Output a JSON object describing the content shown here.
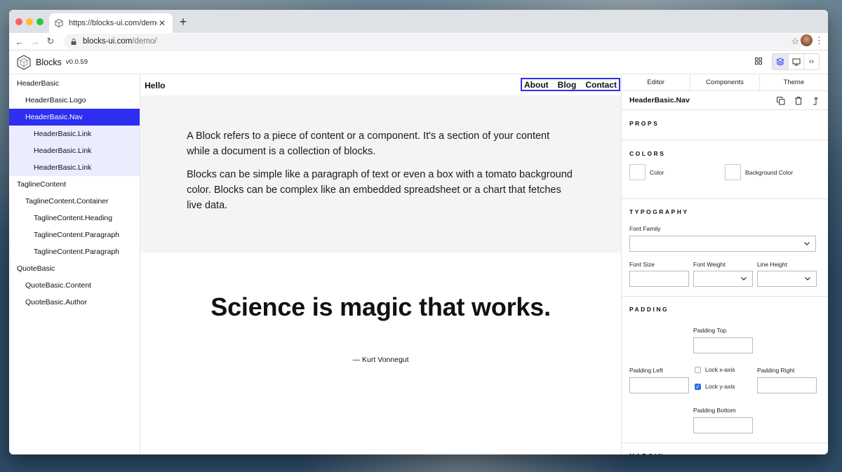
{
  "browser": {
    "tab_title": "https://blocks-ui.com/demo/",
    "url_host": "blocks-ui.com",
    "url_path": "/demo/"
  },
  "app": {
    "brand": "Blocks",
    "version": "v0.0.59",
    "accent_color": "#2d2ef0"
  },
  "tree": [
    {
      "label": "HeaderBasic",
      "level": 0,
      "state": ""
    },
    {
      "label": "HeaderBasic.Logo",
      "level": 1,
      "state": ""
    },
    {
      "label": "HeaderBasic.Nav",
      "level": 1,
      "state": "selected"
    },
    {
      "label": "HeaderBasic.Link",
      "level": 2,
      "state": "child-sel"
    },
    {
      "label": "HeaderBasic.Link",
      "level": 2,
      "state": "child-sel"
    },
    {
      "label": "HeaderBasic.Link",
      "level": 2,
      "state": "child-sel"
    },
    {
      "label": "TaglineContent",
      "level": 0,
      "state": ""
    },
    {
      "label": "TaglineContent.Container",
      "level": 1,
      "state": ""
    },
    {
      "label": "TaglineContent.Heading",
      "level": 2,
      "state": ""
    },
    {
      "label": "TaglineContent.Paragraph",
      "level": 2,
      "state": ""
    },
    {
      "label": "TaglineContent.Paragraph",
      "level": 2,
      "state": ""
    },
    {
      "label": "QuoteBasic",
      "level": 0,
      "state": ""
    },
    {
      "label": "QuoteBasic.Content",
      "level": 1,
      "state": ""
    },
    {
      "label": "QuoteBasic.Author",
      "level": 1,
      "state": ""
    }
  ],
  "canvas": {
    "logo": "Hello",
    "nav": [
      "About",
      "Blog",
      "Contact"
    ],
    "paragraph1": "A Block refers to a piece of content or a component. It's a section of your content while a document is a collection of blocks.",
    "paragraph2": "Blocks can be simple like a paragraph of text or even a box with a tomato background color. Blocks can be complex like an embedded spreadsheet or a chart that fetches live data.",
    "quote": "Science is magic that works.",
    "author": "— Kurt Vonnegut"
  },
  "panel": {
    "tabs": [
      "Editor",
      "Components",
      "Theme"
    ],
    "selected_name": "HeaderBasic.Nav",
    "props_title": "PROPS",
    "colors_title": "COLORS",
    "color_label": "Color",
    "bg_color_label": "Background Color",
    "typography_title": "TYPOGRAPHY",
    "font_family_label": "Font Family",
    "font_size_label": "Font Size",
    "font_weight_label": "Font Weight",
    "line_height_label": "Line Height",
    "padding_title": "PADDING",
    "padding_top_label": "Padding Top",
    "padding_left_label": "Padding Left",
    "padding_right_label": "Padding Right",
    "padding_bottom_label": "Padding Bottom",
    "lock_x_label": "Lock x-axis",
    "lock_y_label": "Lock y-axis",
    "lock_x_checked": false,
    "lock_y_checked": true,
    "margin_title": "MARGIN"
  }
}
